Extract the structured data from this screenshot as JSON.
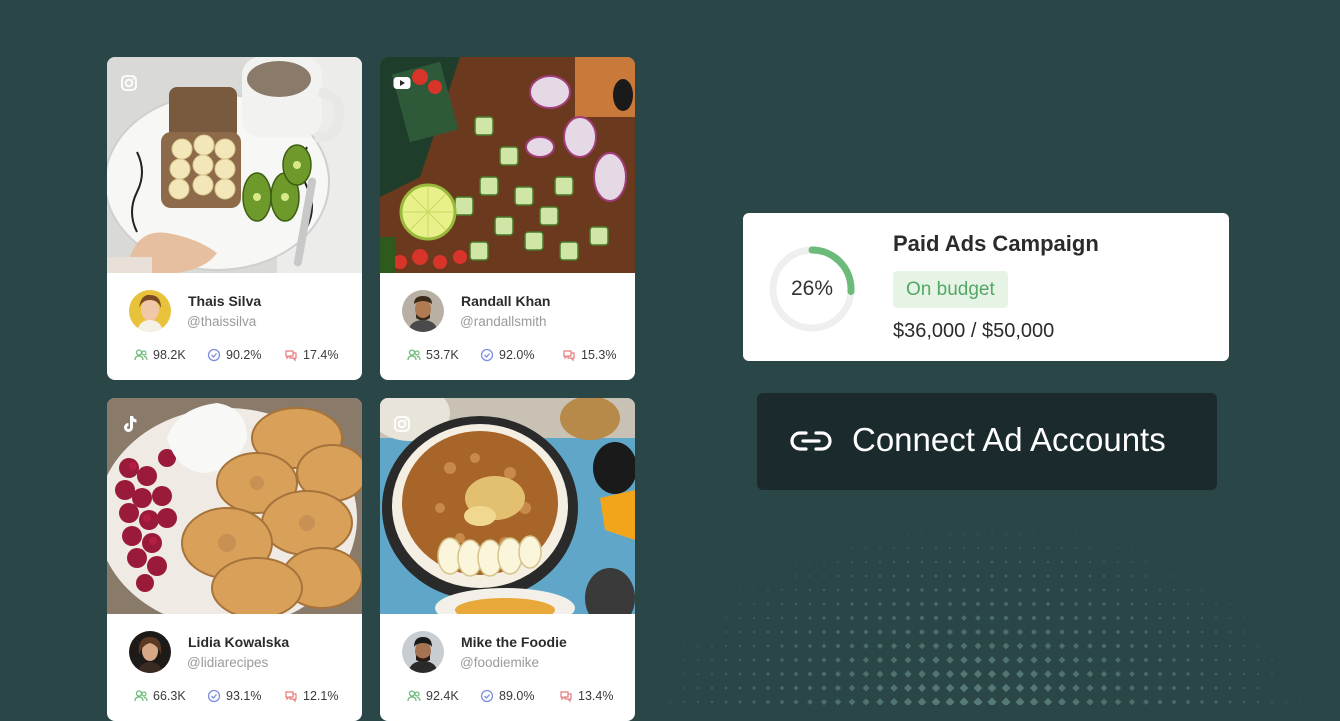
{
  "colors": {
    "background": "#2a4646",
    "card": "#ffffff",
    "progress": "#6dbb7a",
    "badge_bg": "#e6f4e6",
    "badge_text": "#54a764",
    "button_bg": "#1a2a2d"
  },
  "creators": [
    {
      "platform_icon": "instagram-icon",
      "photo": "toast-banana-kiwi-coffee",
      "name": "Thais Silva",
      "handle": "@thaissilva",
      "followers": "98.2K",
      "verified_rate": "90.2%",
      "engagement": "17.4%"
    },
    {
      "platform_icon": "youtube-icon",
      "photo": "cucumber-onion-lemon-board",
      "name": "Randall Khan",
      "handle": "@randallsmith",
      "followers": "53.7K",
      "verified_rate": "92.0%",
      "engagement": "15.3%"
    },
    {
      "platform_icon": "tiktok-icon",
      "photo": "pancakes-raspberries-cottage-cheese",
      "name": "Lidia Kowalska",
      "handle": "@lidiarecipes",
      "followers": "66.3K",
      "verified_rate": "93.1%",
      "engagement": "12.1%"
    },
    {
      "platform_icon": "instagram-icon",
      "photo": "oatmeal-banana-bowl",
      "name": "Mike the Foodie",
      "handle": "@foodiemike",
      "followers": "92.4K",
      "verified_rate": "89.0%",
      "engagement": "13.4%"
    }
  ],
  "campaign": {
    "title": "Paid Ads Campaign",
    "progress_percent": 26,
    "progress_label": "26%",
    "status": "On budget",
    "amount": "$36,000 / $50,000"
  },
  "connect_button": {
    "icon": "link-icon",
    "label": "Connect Ad Accounts"
  }
}
